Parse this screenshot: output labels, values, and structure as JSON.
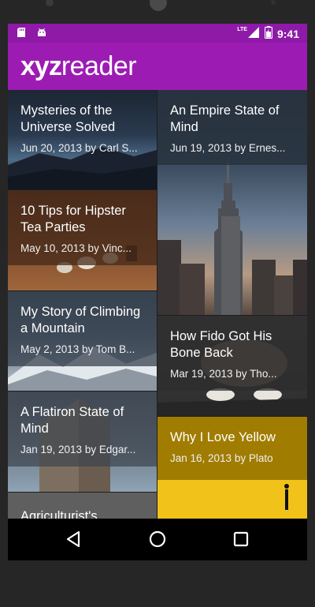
{
  "status_bar": {
    "time": "9:41",
    "network": "LTE",
    "left_icons": [
      "sd-card-icon",
      "android-icon"
    ],
    "right_icons": [
      "lte-signal-icon",
      "battery-icon"
    ]
  },
  "app_bar": {
    "logo_bold": "xyz",
    "logo_regular": "reader",
    "color": "#9c1cb3"
  },
  "articles": [
    {
      "title": "Mysteries of the Universe Solved",
      "meta": "Jun 20, 2013 by Carl S..."
    },
    {
      "title": "An Empire State of Mind",
      "meta": "Jun 19, 2013 by Ernes..."
    },
    {
      "title": "10 Tips for Hipster Tea Parties",
      "meta": "May 10, 2013 by Vinc..."
    },
    {
      "title": "My Story of Climbing a Mountain",
      "meta": "May 2, 2013 by Tom B..."
    },
    {
      "title": "How Fido Got His Bone Back",
      "meta": "Mar 19, 2013 by Tho..."
    },
    {
      "title": "A Flatiron State of Mind",
      "meta": "Jan 19, 2013 by Edgar..."
    },
    {
      "title": "Why I Love Yellow",
      "meta": "Jan 16, 2013 by Plato"
    },
    {
      "title": "Agriculturist's",
      "meta": ""
    }
  ],
  "nav_bar": {
    "icons": [
      "back-icon",
      "home-icon",
      "recents-icon"
    ]
  }
}
